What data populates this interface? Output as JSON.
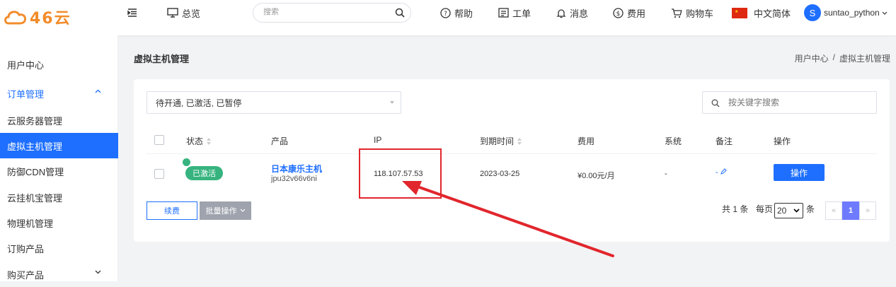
{
  "header": {
    "logo_text": "46云",
    "nav": {
      "overview": "总览",
      "help": "帮助",
      "ticket": "工单",
      "message": "消息",
      "fee": "费用",
      "cart": "购物车",
      "language": "中文简体"
    },
    "search_placeholder": "搜索",
    "user": {
      "initial": "S",
      "name": "suntao_python"
    }
  },
  "sidebar": {
    "items": [
      {
        "label": "用户中心"
      },
      {
        "label": "订单管理"
      },
      {
        "label": "云服务器管理"
      },
      {
        "label": "虚拟主机管理"
      },
      {
        "label": "防御CDN管理"
      },
      {
        "label": "云挂机宝管理"
      },
      {
        "label": "物理机管理"
      },
      {
        "label": "订购产品"
      },
      {
        "label": "购买产品"
      }
    ]
  },
  "page": {
    "title": "虚拟主机管理",
    "breadcrumb": [
      "用户中心",
      "/",
      "虚拟主机管理"
    ]
  },
  "filter": {
    "selected": "待开通, 已激活, 已暂停",
    "keyword_placeholder": "按关键字搜索"
  },
  "table": {
    "headers": [
      "状态",
      "产品",
      "IP",
      "到期时间",
      "费用",
      "系统",
      "备注",
      "操作"
    ],
    "rows": [
      {
        "status": "已激活",
        "product": "日本康乐主机",
        "product_id": "jpu32v66v6ni",
        "ip": "118.107.57.53",
        "expire": "2023-03-25",
        "fee": "¥0.00元/月",
        "system": "-",
        "note": "-",
        "action": "操作"
      }
    ]
  },
  "footer": {
    "renew": "续费",
    "batch": "批量操作",
    "total": "共 1 条",
    "per_page_label": "每页",
    "per_page_value": "20",
    "per_page_unit": "条",
    "prev": "«",
    "current_page": "1",
    "next": "»"
  },
  "colors": {
    "primary": "#1e6fff",
    "success": "#36b37e",
    "annotation": "#e1262d",
    "logo": "#f28c2a"
  }
}
